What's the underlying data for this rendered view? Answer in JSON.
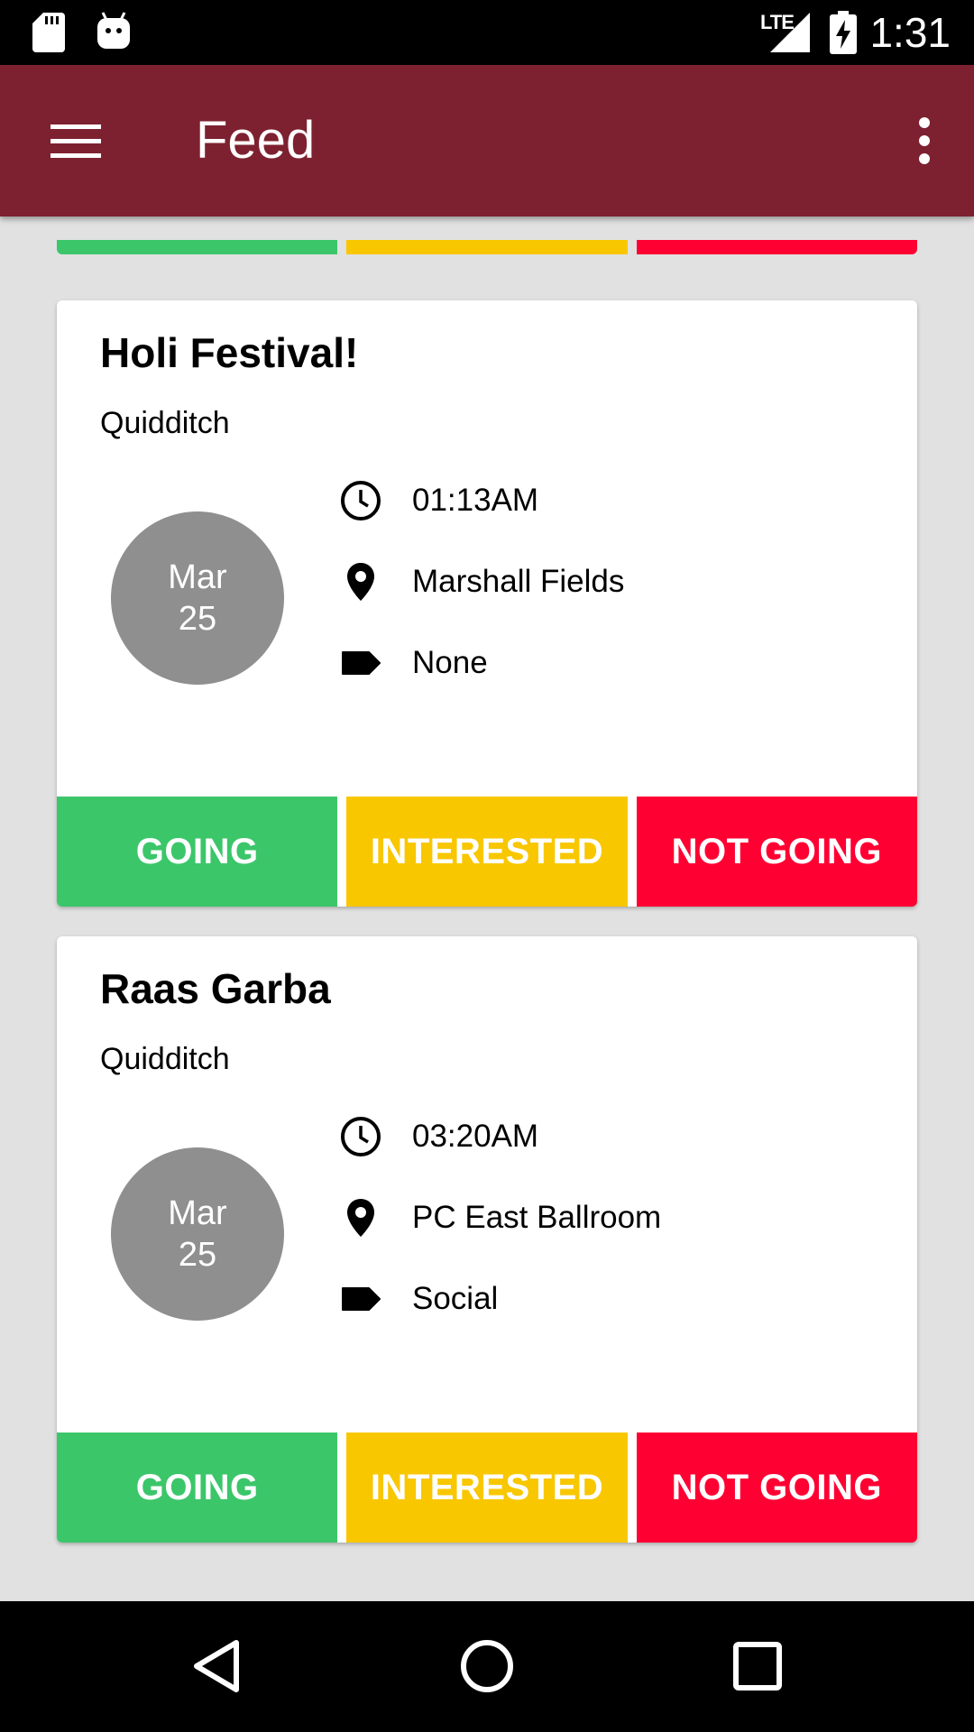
{
  "status_bar": {
    "time": "1:31",
    "network": "LTE"
  },
  "app_bar": {
    "title": "Feed"
  },
  "colors": {
    "app_bar": "#7d2130",
    "going": "#3bc66a",
    "interested": "#f8c700",
    "not_going": "#ff0033",
    "date_circle": "#8f8f8f"
  },
  "events": [
    {
      "title": "Holi Festival!",
      "organization": "Quidditch",
      "month": "Mar",
      "day": "25",
      "time": "01:13AM",
      "location": "Marshall Fields",
      "tag": "None",
      "going_label": "GOING",
      "interested_label": "INTERESTED",
      "not_going_label": "NOT GOING"
    },
    {
      "title": "Raas Garba",
      "organization": "Quidditch",
      "month": "Mar",
      "day": "25",
      "time": "03:20AM",
      "location": "PC East Ballroom",
      "tag": "Social",
      "going_label": "GOING",
      "interested_label": "INTERESTED",
      "not_going_label": "NOT GOING"
    }
  ],
  "icons": [
    "sd-card-icon",
    "android-icon",
    "signal-icon",
    "battery-charging-icon",
    "menu-icon",
    "more-vert-icon",
    "clock-icon",
    "location-pin-icon",
    "label-icon",
    "back-icon",
    "home-icon",
    "recents-icon"
  ]
}
